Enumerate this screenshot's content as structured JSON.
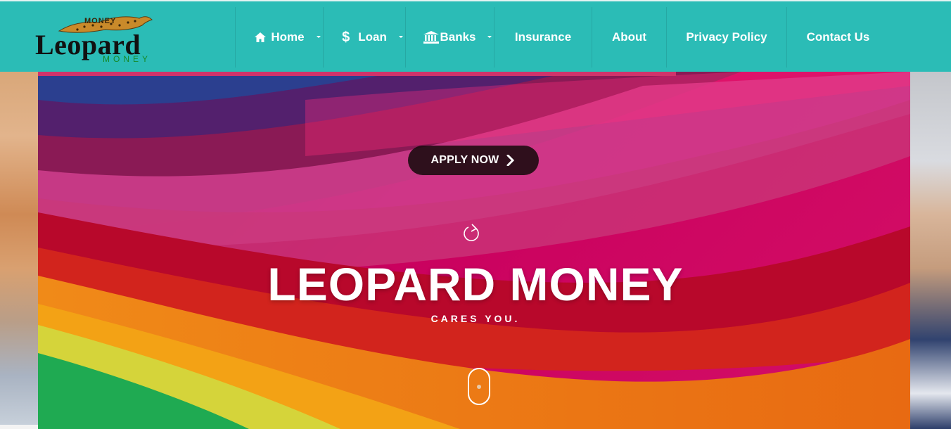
{
  "brand": {
    "logo_word": "Leopard",
    "logo_sub": "MONEY",
    "logo_badge": "MONEY"
  },
  "nav": {
    "items": [
      {
        "label": "Home",
        "icon": "home-icon",
        "dropdown": true
      },
      {
        "label": "Loan",
        "icon": "dollar-icon",
        "dropdown": true
      },
      {
        "label": "Banks",
        "icon": "bank-icon",
        "dropdown": true
      },
      {
        "label": "Insurance",
        "dropdown": false
      },
      {
        "label": "About",
        "dropdown": false
      },
      {
        "label": "Privacy Policy",
        "dropdown": false
      },
      {
        "label": "Contact Us",
        "dropdown": false
      }
    ]
  },
  "hero": {
    "apply_label": "APPLY NOW",
    "title": "LEOPARD MONEY",
    "subtitle": "CARES YOU.",
    "icons": [
      "refresh-icon",
      "chevron-right-icon",
      "scroll-mouse-icon"
    ]
  },
  "colors": {
    "header": "#2bbcb6",
    "progress": "#d0336b",
    "hero_base": "#c4005c"
  }
}
